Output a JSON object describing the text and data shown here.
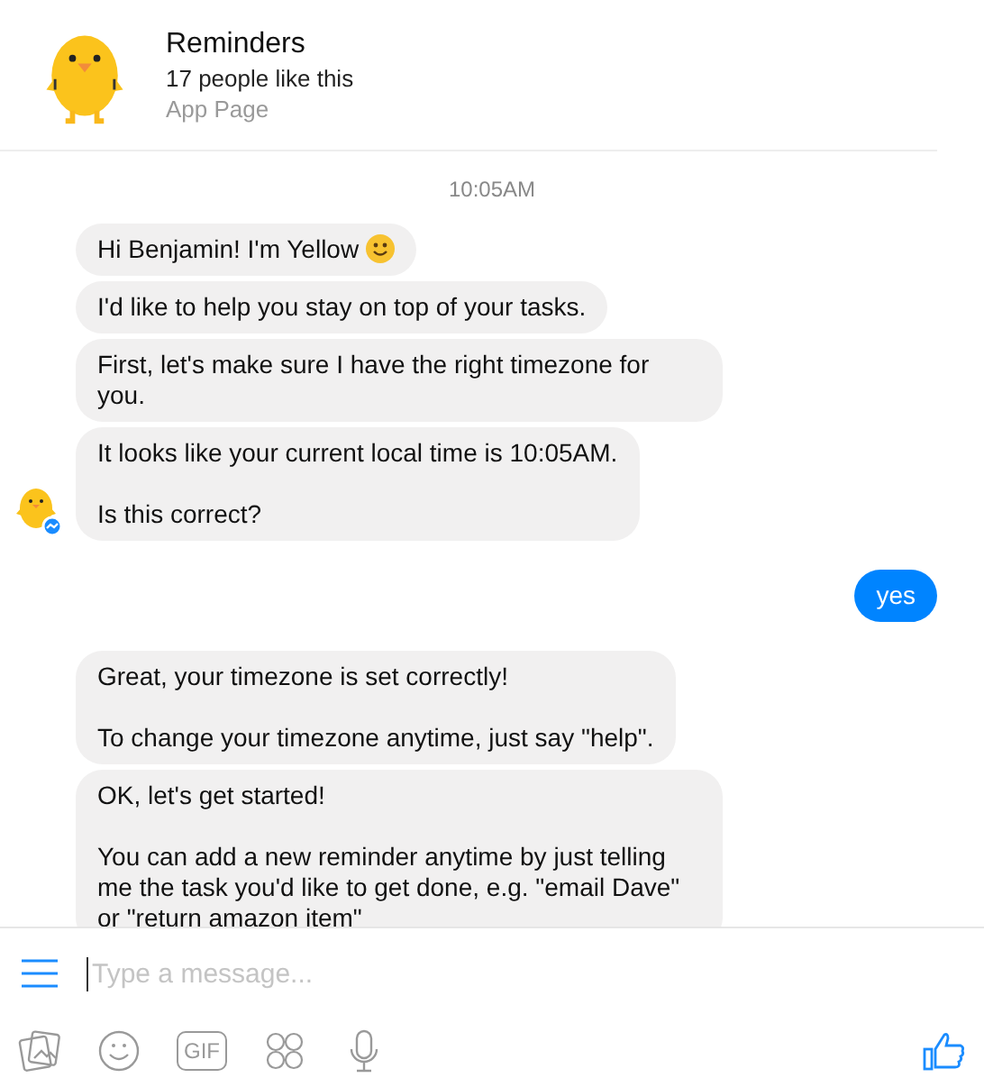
{
  "page": {
    "name": "Reminders",
    "likes": "17 people like this",
    "category": "App Page"
  },
  "timestamp": "10:05AM",
  "groups": [
    {
      "kind": "bot",
      "avatar": true,
      "messages": [
        {
          "text": "Hi Benjamin! I'm Yellow",
          "emoji": true
        },
        {
          "text": "I'd like to help you stay on top of your tasks.",
          "emoji": false
        },
        {
          "text": "First, let's make sure I have the right timezone for you.",
          "emoji": false
        },
        {
          "text": "It looks like your current local time is 10:05AM.\n\nIs this correct?",
          "emoji": false
        }
      ]
    },
    {
      "kind": "user",
      "avatar": false,
      "messages": [
        {
          "text": "yes",
          "emoji": false
        }
      ]
    },
    {
      "kind": "bot",
      "avatar": false,
      "messages": [
        {
          "text": "Great, your timezone is set correctly!\n\nTo change your timezone anytime, just say \"help\".",
          "emoji": false
        },
        {
          "text": "OK, let's get started!\n\nYou can add a new reminder anytime by just telling me the task you'd like to get done, e.g. \"email Dave\" or \"return amazon item\"",
          "emoji": false
        }
      ]
    }
  ],
  "composer": {
    "placeholder": "Type a message...",
    "gif_label": "GIF"
  }
}
